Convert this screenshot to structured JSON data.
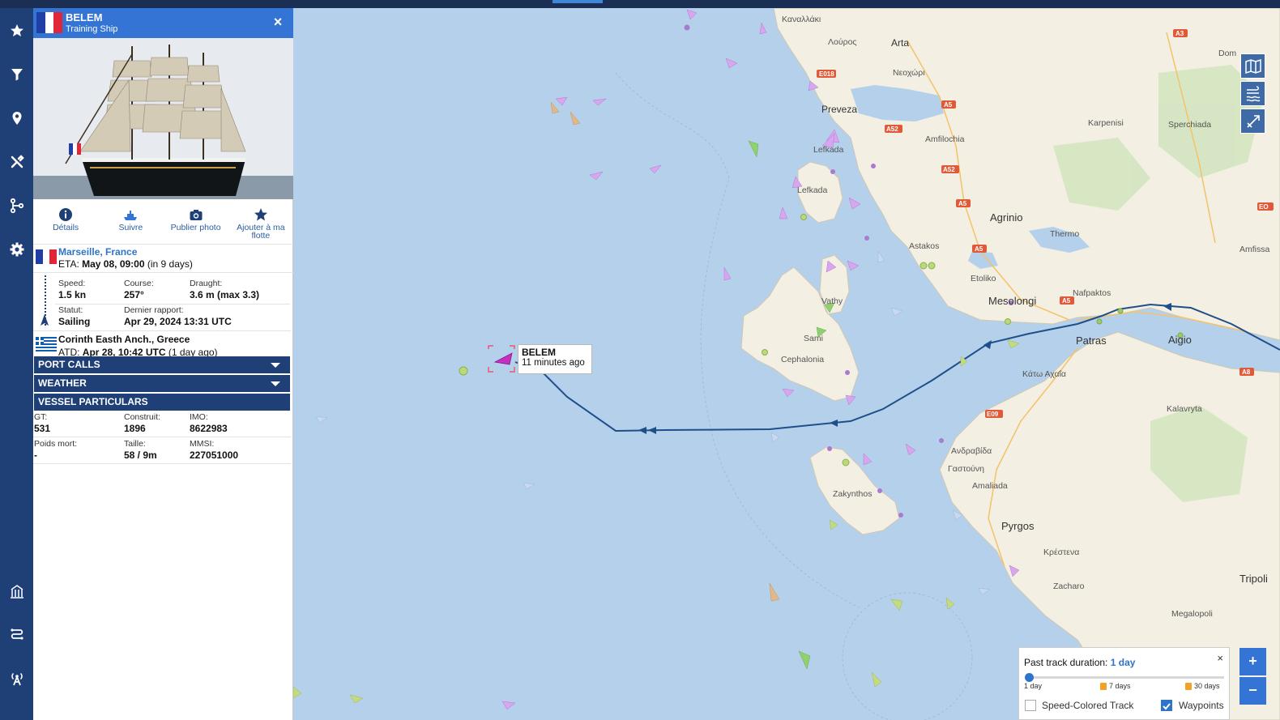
{
  "header": {
    "ship_name": "BELEM",
    "ship_type": "Training Ship",
    "close_icon": "close-icon"
  },
  "actions": [
    {
      "label": "Détails",
      "icon": "info-icon"
    },
    {
      "label": "Suivre",
      "icon": "ship-follow-icon"
    },
    {
      "label": "Publier photo",
      "icon": "camera-icon"
    },
    {
      "label": "Ajouter à ma flotte",
      "icon": "star-icon"
    }
  ],
  "destination": {
    "name": "Marseille, France",
    "eta_label": "ETA:",
    "eta_value": "May 08, 09:00",
    "eta_rel": "(in 9 days)"
  },
  "voyage": {
    "speed_label": "Speed:",
    "speed_value": "1.5 kn",
    "course_label": "Course:",
    "course_value": "257°",
    "draught_label": "Draught:",
    "draught_value": "3.6 m (max 3.3)",
    "status_label": "Statut:",
    "status_value": "Sailing",
    "last_report_label": "Dernier rapport:",
    "last_report_value": "Apr 29, 2024 13:31 UTC"
  },
  "origin": {
    "name": "Corinth Easth Anch., Greece",
    "atd_label": "ATD:",
    "atd_value": "Apr 28, 10:42 UTC",
    "atd_rel": "(1 day ago)"
  },
  "accordions": {
    "port_calls": "PORT CALLS",
    "weather": "WEATHER",
    "particulars": "VESSEL PARTICULARS"
  },
  "particulars": {
    "gt_label": "GT:",
    "gt_value": "531",
    "built_label": "Construit:",
    "built_value": "1896",
    "imo_label": "IMO:",
    "imo_value": "8622983",
    "dwt_label": "Poids mort:",
    "dwt_value": "-",
    "size_label": "Taille:",
    "size_value": "58 / 9m",
    "mmsi_label": "MMSI:",
    "mmsi_value": "227051000"
  },
  "map": {
    "vessel_label_name": "BELEM",
    "vessel_label_time": "11 minutes ago",
    "places": {
      "kanallaki": "Καναλλάκι",
      "arta": "Arta",
      "louros": "Λούρος",
      "neochori": "Νεοχώρι",
      "preveza": "Preveza",
      "amfilochia": "Amfilochia",
      "karpenisi": "Karpenisi",
      "sperchiada": "Sperchiada",
      "lefkada": "Lefkada",
      "lefkada2": "Lefkada",
      "agrinio": "Agrinio",
      "thermo": "Thermo",
      "astakos": "Astakos",
      "amfissa": "Amfissa",
      "etoliko": "Etoliko",
      "nafpaktos": "Nafpaktos",
      "mesolongi": "Mesolongi",
      "vathy": "Vathy",
      "sami": "Sami",
      "cephalonia": "Cephalonia",
      "patras": "Patras",
      "aigio": "Aigio",
      "kato_achaia": "Κάτω Αχαΐα",
      "kalavryta": "Kalavryta",
      "andravida": "Ανδραβίδα",
      "gastouni": "Γαστούνη",
      "amaliada": "Amaliada",
      "zakynthos": "Zakynthos",
      "pyrgos": "Pyrgos",
      "krestena": "Κρέστενα",
      "zacharo": "Zacharo",
      "tripoli": "Tripoli",
      "megalopoli": "Megalopoli",
      "dom": "Dom"
    },
    "road_shields": [
      "E018",
      "A5",
      "A52",
      "A52",
      "A5",
      "A5",
      "A5",
      "A3",
      "E09",
      "A8",
      "EO"
    ]
  },
  "track_duration": {
    "title": "Past track duration:",
    "value": "1 day",
    "tick_1": "1 day",
    "tick_7": "7 days",
    "tick_30": "30 days",
    "speed_colored": "Speed-Colored Track",
    "waypoints": "Waypoints",
    "close_icon": "close-icon"
  },
  "map_controls": {
    "zoom_in": "+",
    "zoom_out": "−"
  },
  "colors": {
    "sea": "#b5d0ea",
    "land": "#f4f1e7",
    "rail": "#1f3f77",
    "header": "#3474d4",
    "track": "#1f4f8a"
  }
}
